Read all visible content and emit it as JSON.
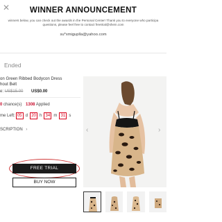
{
  "announcement": {
    "close_icon": "close-icon",
    "title": "WINNER ANNOUNCEMENT",
    "body_line1": "winners below, you can check out the awards in the Personal Center! Thank you to everyone who participa",
    "body_line2": "questions, please feel free to contact freetrial@shein.com",
    "email": "su*xmiguplla@yahoo.com"
  },
  "product": {
    "status": "Ended",
    "title_line1": "on Green Ribbed Bodycon Dress",
    "title_line2": "hout Belt",
    "price_prefix": "e:",
    "price_old": "US$15.00",
    "price_now": "US$0.00",
    "chances_count": "0",
    "chances_text": "chance(s)",
    "applied_count": "1308",
    "applied_text": "Applied",
    "time_left_label": "me Left:",
    "timer": {
      "days": "05",
      "days_unit": "d",
      "hours": "20",
      "hours_unit": "h",
      "minutes": "34",
      "minutes_unit": "m",
      "seconds": "31",
      "seconds_unit": "s"
    },
    "description_label": "SCRIPTION"
  },
  "buttons": {
    "free_trial": "FREE TRIAL",
    "buy_now": "BUY NOW"
  },
  "gallery": {
    "prev_icon": "chevron-left-icon",
    "next_icon": "chevron-right-icon",
    "thumb_count": 4
  },
  "colors": {
    "accent_red": "#d9001b",
    "button_dark": "#1b1b1b",
    "annotation_circle": "#d13a3a"
  }
}
